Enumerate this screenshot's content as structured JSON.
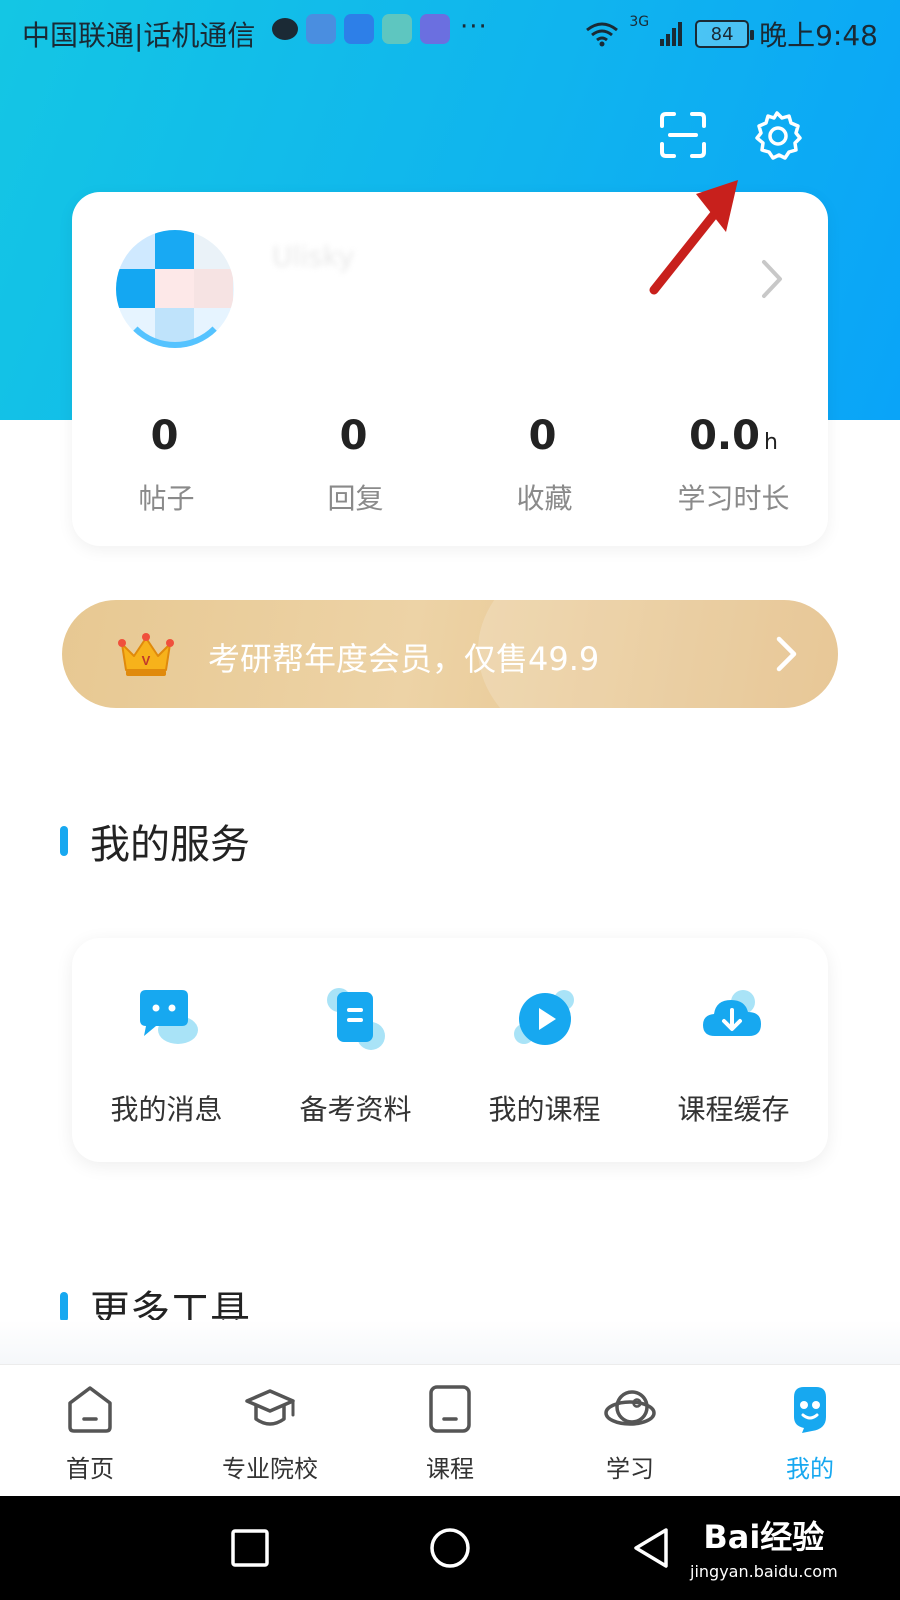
{
  "status_bar": {
    "carrier": "中国联通|话机通信",
    "more": "···",
    "network": "3G",
    "battery": "84",
    "time": "晚上9:48"
  },
  "header": {
    "scan_icon": "scan-icon",
    "settings_icon": "gear-icon"
  },
  "profile": {
    "username": "Ulisky",
    "stats": [
      {
        "value": "0",
        "unit": "",
        "label": "帖子"
      },
      {
        "value": "0",
        "unit": "",
        "label": "回复"
      },
      {
        "value": "0",
        "unit": "",
        "label": "收藏"
      },
      {
        "value": "0.0",
        "unit": "h",
        "label": "学习时长"
      }
    ]
  },
  "vip_banner": {
    "text": "考研帮年度会员，仅售49.9",
    "icon": "crown-icon"
  },
  "services": {
    "title": "我的服务",
    "items": [
      {
        "label": "我的消息",
        "icon": "message-icon"
      },
      {
        "label": "备考资料",
        "icon": "document-icon"
      },
      {
        "label": "我的课程",
        "icon": "play-icon"
      },
      {
        "label": "课程缓存",
        "icon": "cloud-download-icon"
      }
    ]
  },
  "tools": {
    "title": "更多工具"
  },
  "bottom_nav": {
    "items": [
      {
        "label": "首页",
        "icon": "home-icon",
        "active": false
      },
      {
        "label": "专业院校",
        "icon": "graduation-cap-icon",
        "active": false
      },
      {
        "label": "课程",
        "icon": "course-icon",
        "active": false
      },
      {
        "label": "学习",
        "icon": "planet-icon",
        "active": false
      },
      {
        "label": "我的",
        "icon": "mascot-icon",
        "active": true
      }
    ]
  },
  "colors": {
    "accent": "#17a8f0",
    "header_gradient_start": "#14c6e4",
    "header_gradient_end": "#0aa4f8",
    "vip_gold": "#e7c892",
    "annotation_arrow": "#c8201c"
  },
  "watermark": {
    "logo": "Bai经验",
    "url": "jingyan.baidu.com"
  }
}
